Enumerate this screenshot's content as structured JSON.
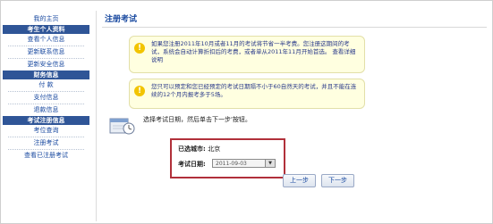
{
  "sidebar": {
    "home_link": "我的主页",
    "sections": [
      {
        "header": "考生个人资料",
        "items": [
          "查看个人信息",
          "更新联系信息",
          "更新安全信息"
        ]
      },
      {
        "header": "财务信息",
        "items": [
          "付 款",
          "支付信息",
          "退款信息"
        ]
      },
      {
        "header": "考试注册信息",
        "items": [
          "考位查询",
          "注册考试",
          "查看已注册考试"
        ]
      }
    ]
  },
  "main": {
    "title": "注册考试",
    "notice1": "如果您注册2011年10月或者11月的考试将节省一半考费。您注册这期间的考试，系统会自动计算折扣后的考费，或者单从2011年11月开始首选。 查看详细说明",
    "notice2": "您只可以预定和您已经预定的考试日期隔不小于60自然天的考试，并且不能在连续的12个月内报考多于5场。",
    "instruction": "选择考试日期，然后单击下一步'按钮。",
    "selected_city_label": "已选城市:",
    "selected_city_value": "北京",
    "exam_date_label": "考试日期:",
    "exam_date_value": "2011-09-03",
    "prev_button": "上一步",
    "next_button": "下一步"
  },
  "colors": {
    "nav_header": "#2f5597",
    "link": "#1a4aa0",
    "notice_bg": "#ffffe0",
    "highlight_border": "#b1303a"
  }
}
